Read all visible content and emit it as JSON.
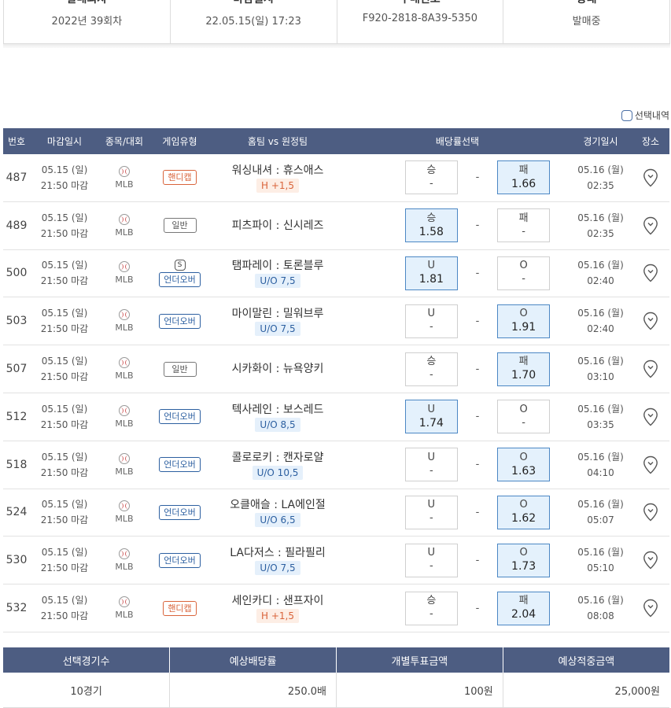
{
  "top_info": [
    {
      "label": "발매회차",
      "value": "2022년 39회차"
    },
    {
      "label": "마감일시",
      "value": "22.05.15(일) 17:23"
    },
    {
      "label": "구매번호",
      "value": "F920-2818-8A39-5350"
    },
    {
      "label": "상태",
      "value": "발매중"
    }
  ],
  "selection_toggle_label": "선택내역",
  "table": {
    "headers": [
      "번호",
      "마감일시",
      "종목/대회",
      "게임유형",
      "홈팀 vs 원정팀",
      "배당률선택",
      "경기일시",
      "장소"
    ],
    "rows": [
      {
        "no": "487",
        "close_date": "05.15 (일)",
        "close_time": "21:50 마감",
        "league": "MLB",
        "game_type": "핸디캡",
        "type_style": "red",
        "s_mark": "",
        "home": "워싱내셔",
        "away": "휴스애스",
        "handicap": "H +1,5",
        "hc_style": "red",
        "left_label": "승",
        "left_value": "-",
        "left_selected": false,
        "draw": "-",
        "right_label": "패",
        "right_value": "1.66",
        "right_selected": true,
        "game_date": "05.16 (월)",
        "game_time": "02:35"
      },
      {
        "no": "489",
        "close_date": "05.15 (일)",
        "close_time": "21:50 마감",
        "league": "MLB",
        "game_type": "일반",
        "type_style": "gray",
        "s_mark": "",
        "home": "피츠파이",
        "away": "신시레즈",
        "handicap": "",
        "hc_style": "",
        "left_label": "승",
        "left_value": "1.58",
        "left_selected": true,
        "draw": "-",
        "right_label": "패",
        "right_value": "-",
        "right_selected": false,
        "game_date": "05.16 (월)",
        "game_time": "02:35"
      },
      {
        "no": "500",
        "close_date": "05.15 (일)",
        "close_time": "21:50 마감",
        "league": "MLB",
        "game_type": "언더오버",
        "type_style": "blue",
        "s_mark": "S",
        "home": "탬파레이",
        "away": "토론블루",
        "handicap": "U/O 7,5",
        "hc_style": "blue",
        "left_label": "U",
        "left_value": "1.81",
        "left_selected": true,
        "draw": "-",
        "right_label": "O",
        "right_value": "-",
        "right_selected": false,
        "game_date": "05.16 (월)",
        "game_time": "02:40"
      },
      {
        "no": "503",
        "close_date": "05.15 (일)",
        "close_time": "21:50 마감",
        "league": "MLB",
        "game_type": "언더오버",
        "type_style": "blue",
        "s_mark": "",
        "home": "마이말린",
        "away": "밀워브루",
        "handicap": "U/O 7,5",
        "hc_style": "blue",
        "left_label": "U",
        "left_value": "-",
        "left_selected": false,
        "draw": "-",
        "right_label": "O",
        "right_value": "1.91",
        "right_selected": true,
        "game_date": "05.16 (월)",
        "game_time": "02:40"
      },
      {
        "no": "507",
        "close_date": "05.15 (일)",
        "close_time": "21:50 마감",
        "league": "MLB",
        "game_type": "일반",
        "type_style": "gray",
        "s_mark": "",
        "home": "시카화이",
        "away": "뉴욕양키",
        "handicap": "",
        "hc_style": "",
        "left_label": "승",
        "left_value": "-",
        "left_selected": false,
        "draw": "-",
        "right_label": "패",
        "right_value": "1.70",
        "right_selected": true,
        "game_date": "05.16 (월)",
        "game_time": "03:10"
      },
      {
        "no": "512",
        "close_date": "05.15 (일)",
        "close_time": "21:50 마감",
        "league": "MLB",
        "game_type": "언더오버",
        "type_style": "blue",
        "s_mark": "",
        "home": "텍사레인",
        "away": "보스레드",
        "handicap": "U/O 8,5",
        "hc_style": "blue",
        "left_label": "U",
        "left_value": "1.74",
        "left_selected": true,
        "draw": "-",
        "right_label": "O",
        "right_value": "-",
        "right_selected": false,
        "game_date": "05.16 (월)",
        "game_time": "03:35"
      },
      {
        "no": "518",
        "close_date": "05.15 (일)",
        "close_time": "21:50 마감",
        "league": "MLB",
        "game_type": "언더오버",
        "type_style": "blue",
        "s_mark": "",
        "home": "콜로로키",
        "away": "캔자로얄",
        "handicap": "U/O 10,5",
        "hc_style": "blue",
        "left_label": "U",
        "left_value": "-",
        "left_selected": false,
        "draw": "-",
        "right_label": "O",
        "right_value": "1.63",
        "right_selected": true,
        "game_date": "05.16 (월)",
        "game_time": "04:10"
      },
      {
        "no": "524",
        "close_date": "05.15 (일)",
        "close_time": "21:50 마감",
        "league": "MLB",
        "game_type": "언더오버",
        "type_style": "blue",
        "s_mark": "",
        "home": "오클애슬",
        "away": "LA에인절",
        "handicap": "U/O 6,5",
        "hc_style": "blue",
        "left_label": "U",
        "left_value": "-",
        "left_selected": false,
        "draw": "-",
        "right_label": "O",
        "right_value": "1.62",
        "right_selected": true,
        "game_date": "05.16 (월)",
        "game_time": "05:07"
      },
      {
        "no": "530",
        "close_date": "05.15 (일)",
        "close_time": "21:50 마감",
        "league": "MLB",
        "game_type": "언더오버",
        "type_style": "blue",
        "s_mark": "",
        "home": "LA다저스",
        "away": "필라필리",
        "handicap": "U/O 7,5",
        "hc_style": "blue",
        "left_label": "U",
        "left_value": "-",
        "left_selected": false,
        "draw": "-",
        "right_label": "O",
        "right_value": "1.73",
        "right_selected": true,
        "game_date": "05.16 (월)",
        "game_time": "05:10"
      },
      {
        "no": "532",
        "close_date": "05.15 (일)",
        "close_time": "21:50 마감",
        "league": "MLB",
        "game_type": "핸디캡",
        "type_style": "red",
        "s_mark": "",
        "home": "세인카디",
        "away": "샌프자이",
        "handicap": "H +1,5",
        "hc_style": "red",
        "left_label": "승",
        "left_value": "-",
        "left_selected": false,
        "draw": "-",
        "right_label": "패",
        "right_value": "2.04",
        "right_selected": true,
        "game_date": "05.16 (월)",
        "game_time": "08:08"
      }
    ]
  },
  "summary": {
    "headers": [
      "선택경기수",
      "예상배당률",
      "개별투표금액",
      "예상적중금액"
    ],
    "values": [
      "10경기",
      "250.0배",
      "100원",
      "25,000원"
    ]
  },
  "colors": {
    "header_bg": "#4d5d82",
    "selected_bg": "#e4f1fc",
    "handicap_red": "#d9643b",
    "underover_blue": "#2c5fa0"
  }
}
